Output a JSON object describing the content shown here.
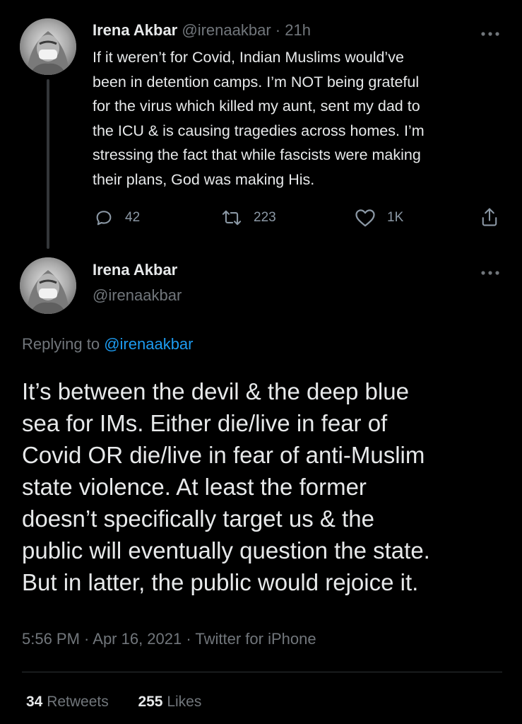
{
  "parent_tweet": {
    "author_name": "Irena Akbar",
    "handle": "@irenaakbar",
    "separator": "·",
    "time_ago": "21h",
    "text_lines": [
      "If it weren’t for Covid, Indian Muslims would’ve",
      "been in detention camps. I’m NOT being grateful",
      "for the virus which killed my aunt, sent my dad to",
      "the ICU & is causing tragedies across homes. I’m",
      "stressing the fact that while fascists were making",
      "their plans, God was making His."
    ],
    "replies": "42",
    "retweets": "223",
    "likes": "1K"
  },
  "main_tweet": {
    "author_name": "Irena Akbar",
    "handle": "@irenaakbar",
    "replying_prefix": "Replying to",
    "replying_to": "@irenaakbar",
    "text_lines": [
      "It’s between the devil & the deep blue",
      "sea for IMs. Either die/live in fear of",
      "Covid OR die/live in fear of anti-Muslim",
      "state violence. At least the former",
      "doesn’t specifically target us & the",
      "public will eventually question the state.",
      "But in latter, the public would rejoice it."
    ],
    "meta": "5:56 PM · Apr 16, 2021 · Twitter for iPhone",
    "retweet_count": "34",
    "retweet_label": "Retweets",
    "like_count": "255",
    "like_label": "Likes"
  },
  "colors": {
    "background": "#000000",
    "primary_text": "#e7e9ea",
    "secondary_text": "#71767b",
    "link": "#1d9bf0",
    "divider": "#2f3336"
  },
  "icons": [
    "reply-icon",
    "retweet-icon",
    "like-icon",
    "share-icon",
    "more-icon"
  ]
}
